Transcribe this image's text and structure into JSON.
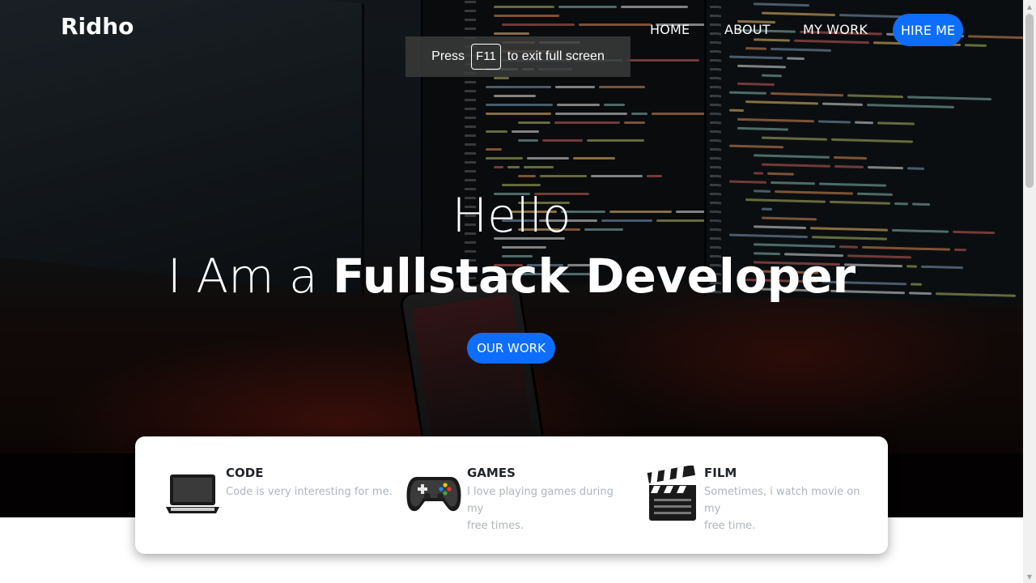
{
  "nav": {
    "brand": "Ridho",
    "links": [
      "HOME",
      "ABOUT",
      "MY WORK"
    ],
    "cta": "HIRE ME"
  },
  "fullscreen_notice": {
    "prefix": "Press",
    "key": "F11",
    "suffix": "to exit full screen"
  },
  "hero": {
    "greeting": "Hello",
    "tagline_light": "I Am a",
    "tagline_bold": "Fullstack Developer",
    "cta": "OUR WORK"
  },
  "features": [
    {
      "icon": "laptop-icon",
      "title": "CODE",
      "desc": "Code is very interesting for me."
    },
    {
      "icon": "gamepad-icon",
      "title": "GAMES",
      "desc_line1": "I love playing games during my",
      "desc_line2": "free times."
    },
    {
      "icon": "clapperboard-icon",
      "title": "FILM",
      "desc_line1": "Sometimes, i watch movie on my",
      "desc_line2": "free time."
    }
  ],
  "colors": {
    "accent": "#0d6efd",
    "text_dark": "#212529",
    "text_muted": "#adb5bd"
  }
}
